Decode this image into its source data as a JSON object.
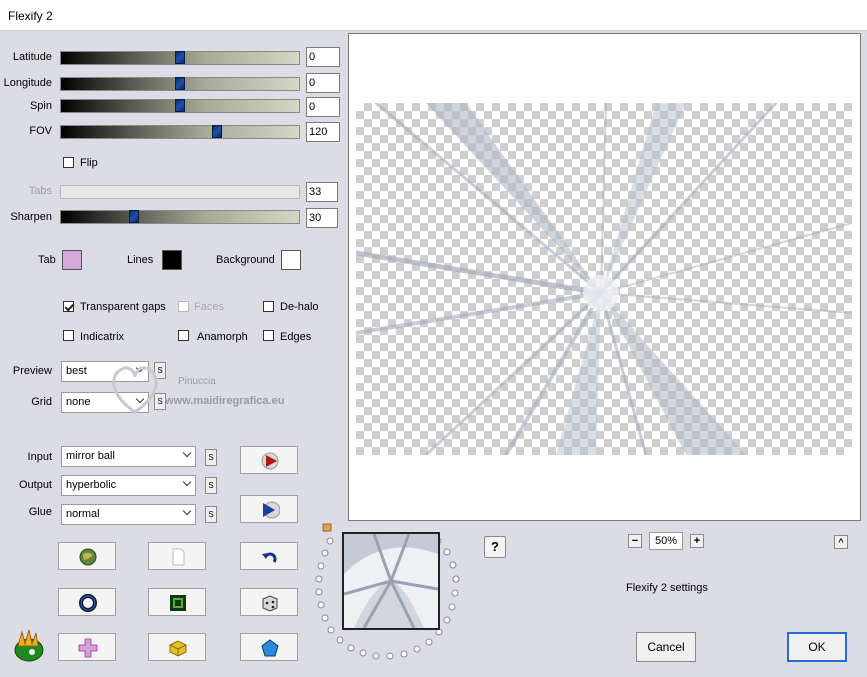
{
  "window": {
    "title": "Flexify 2"
  },
  "sliders": [
    {
      "label": "Latitude",
      "value": "0",
      "position": 0.5,
      "disabled": false
    },
    {
      "label": "Longitude",
      "value": "0",
      "position": 0.5,
      "disabled": false
    },
    {
      "label": "Spin",
      "value": "0",
      "position": 0.5,
      "disabled": false
    },
    {
      "label": "FOV",
      "value": "120",
      "position": 0.67,
      "disabled": false
    },
    {
      "label": "Tabs",
      "value": "33",
      "position": null,
      "disabled": true
    },
    {
      "label": "Sharpen",
      "value": "30",
      "position": 0.3,
      "disabled": false
    }
  ],
  "flip": {
    "label": "Flip",
    "checked": false
  },
  "colors": {
    "tab": {
      "label": "Tab",
      "color": "#d6a8dc"
    },
    "lines": {
      "label": "Lines",
      "color": "#000000"
    },
    "background": {
      "label": "Background",
      "color": "#ffffff"
    }
  },
  "options": {
    "transparent_gaps": {
      "label": "Transparent gaps",
      "checked": true
    },
    "faces": {
      "label": "Faces",
      "checked": false,
      "disabled": true
    },
    "de_halo": {
      "label": "De-halo",
      "checked": false
    },
    "indicatrix": {
      "label": "Indicatrix",
      "checked": false
    },
    "anamorph": {
      "label": "Anamorph",
      "checked": false
    },
    "edges": {
      "label": "Edges",
      "checked": false
    }
  },
  "selects": {
    "preview": {
      "label": "Preview",
      "value": "best"
    },
    "grid": {
      "label": "Grid",
      "value": "none"
    },
    "input": {
      "label": "Input",
      "value": "mirror ball"
    },
    "output": {
      "label": "Output",
      "value": "hyperbolic"
    },
    "glue": {
      "label": "Glue",
      "value": "normal"
    }
  },
  "s_label": "S",
  "watermark": {
    "line1": "Pinuccia",
    "line2": "www.maidiregrafica.eu"
  },
  "zoom": {
    "minus": "−",
    "value": "50%",
    "plus": "+",
    "collapse": "^"
  },
  "help": {
    "label": "?"
  },
  "status_text": "Flexify 2 settings",
  "buttons": {
    "cancel": "Cancel",
    "ok": "OK"
  },
  "icons": [
    "play-red-icon",
    "play-blue-icon",
    "globe-icon",
    "page-icon",
    "undo-icon",
    "ring-icon",
    "square-icon",
    "dice-icon",
    "logo-icon",
    "puzzle-icon",
    "cube-icon",
    "gem-icon"
  ]
}
